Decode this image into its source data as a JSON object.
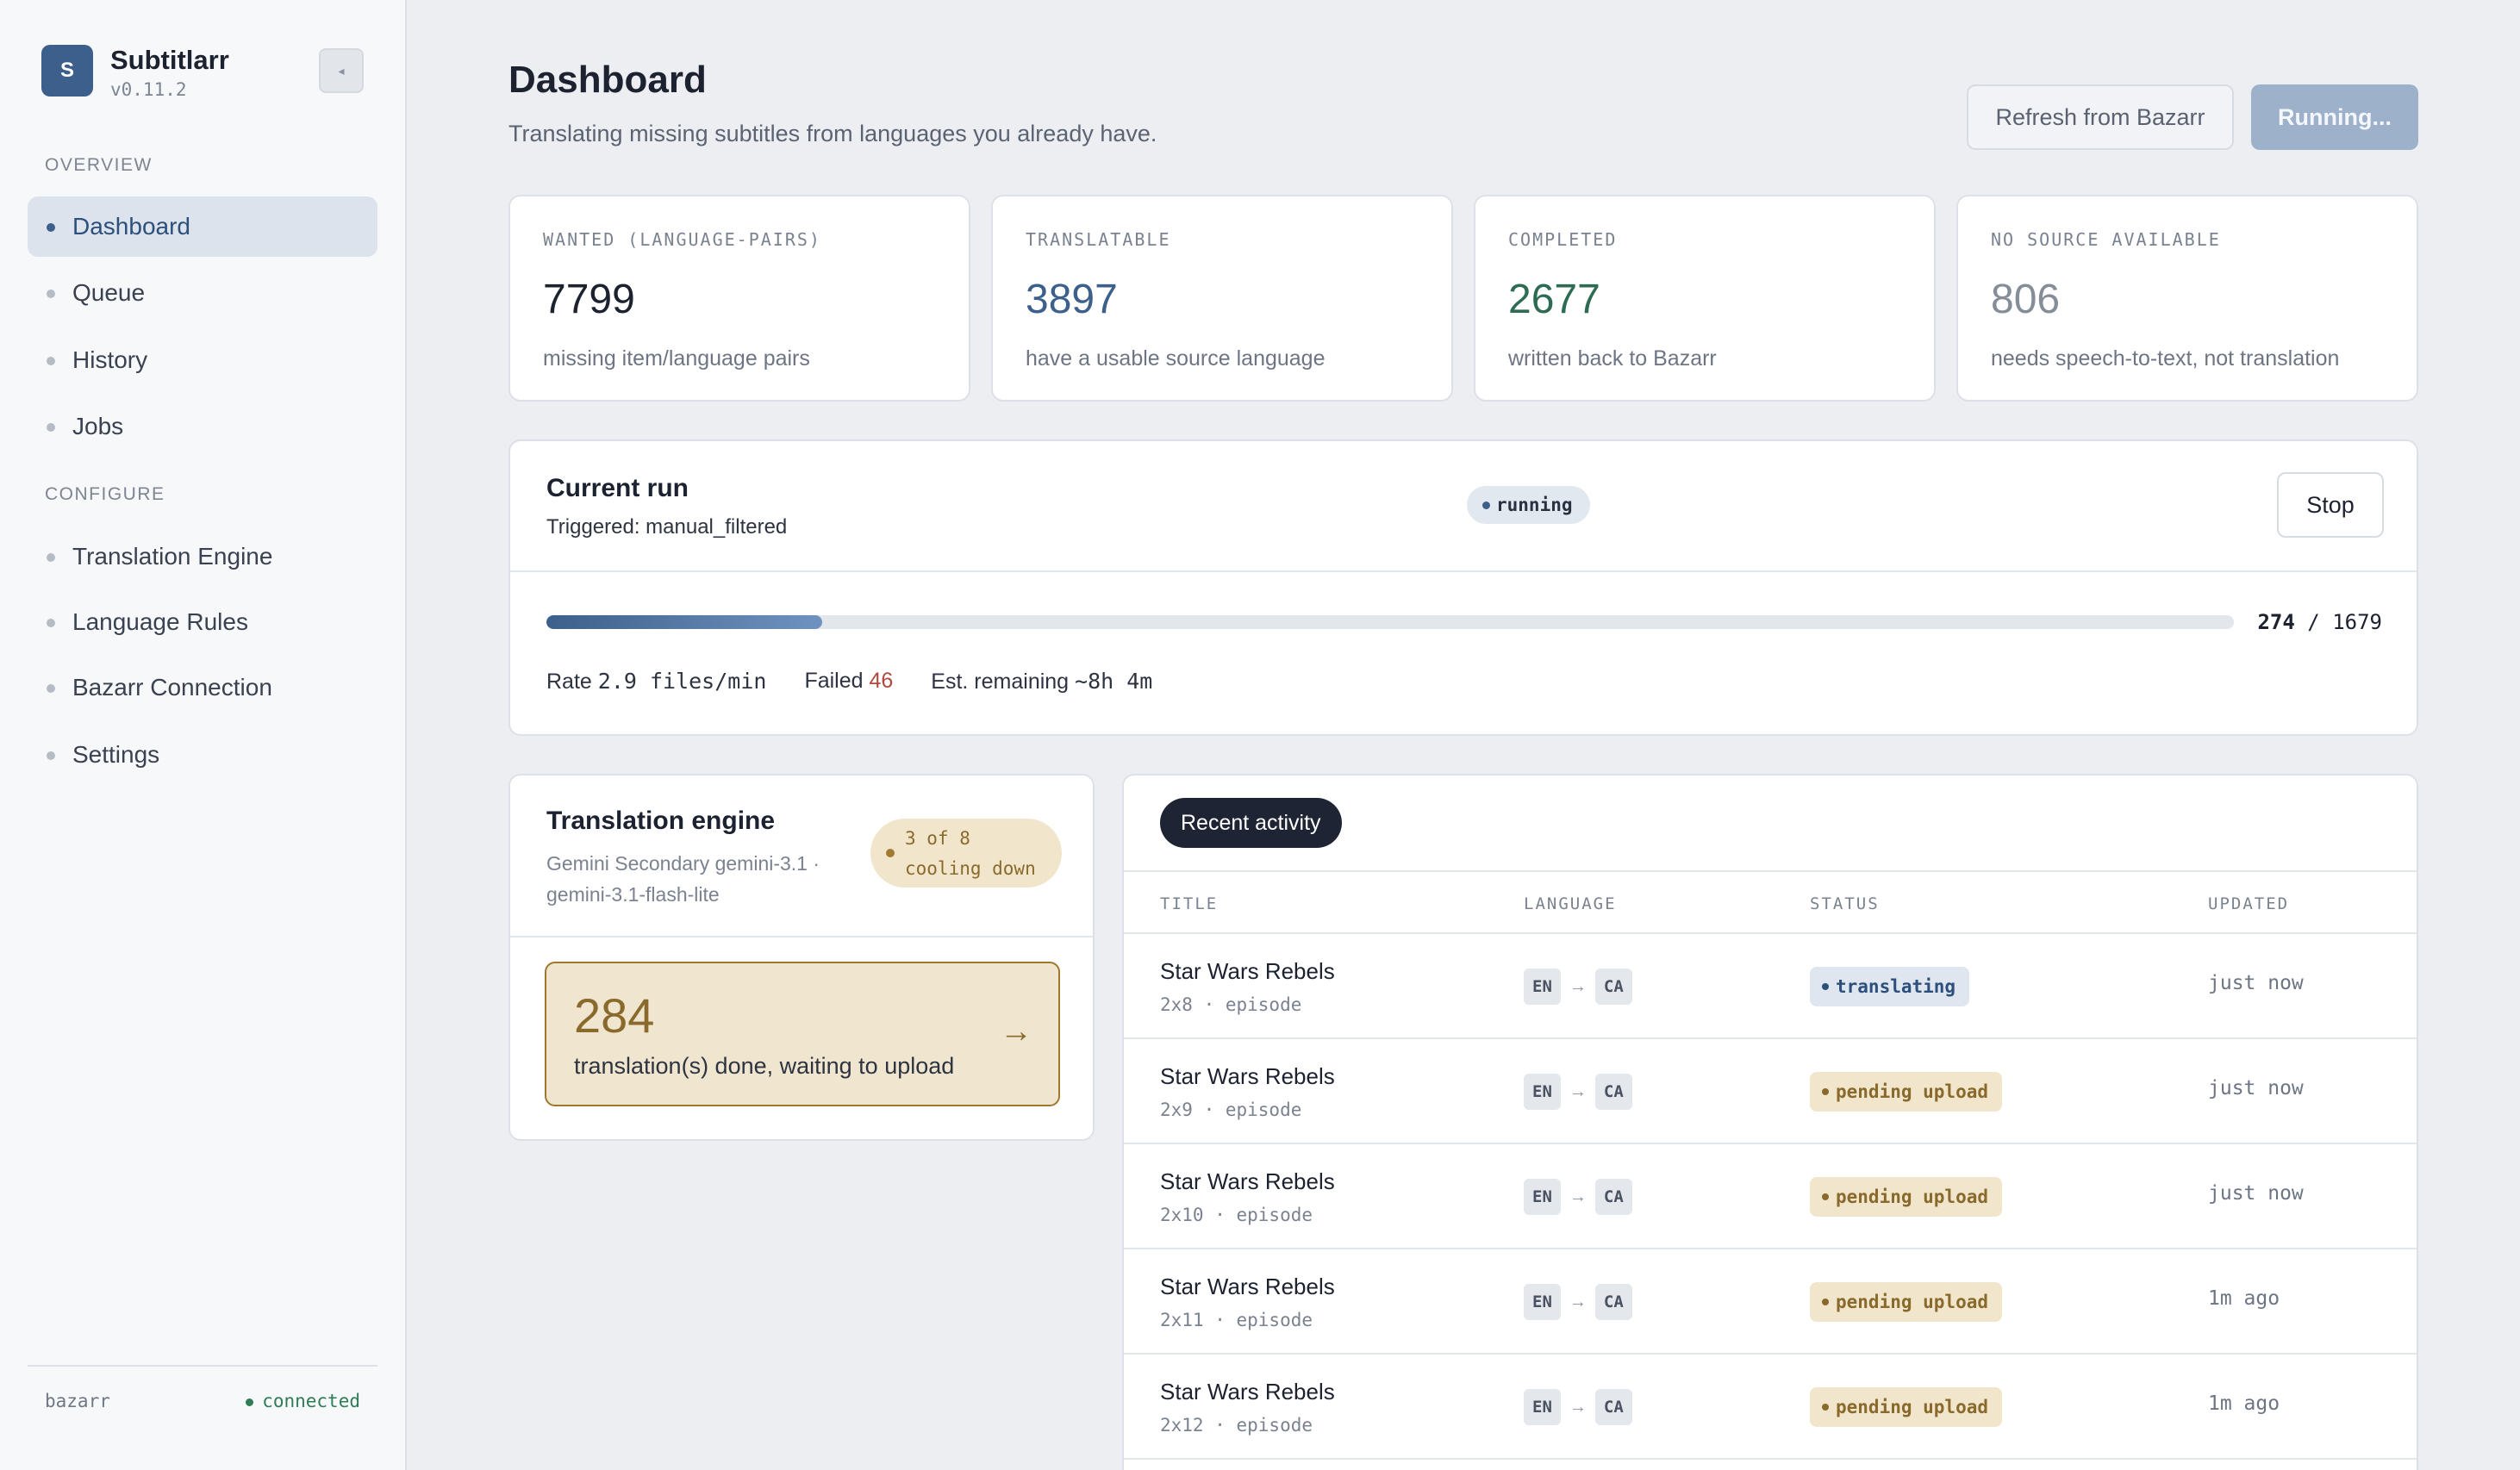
{
  "app": {
    "name": "Subtitlarr",
    "version": "v0.11.2",
    "logo_letter": "S",
    "collapse_icon": "◂"
  },
  "nav": {
    "overview_label": "OVERVIEW",
    "configure_label": "CONFIGURE",
    "overview_items": [
      {
        "label": "Dashboard",
        "active": true
      },
      {
        "label": "Queue"
      },
      {
        "label": "History"
      },
      {
        "label": "Jobs"
      }
    ],
    "configure_items": [
      {
        "label": "Translation Engine"
      },
      {
        "label": "Language Rules"
      },
      {
        "label": "Bazarr Connection"
      },
      {
        "label": "Settings"
      }
    ]
  },
  "footer": {
    "label": "bazarr",
    "status": "connected",
    "status_color": "#2e7d55"
  },
  "header": {
    "title": "Dashboard",
    "subtitle": "Translating missing subtitles from languages you already have.",
    "refresh_label": "Refresh from Bazarr",
    "running_label": "Running..."
  },
  "stats": [
    {
      "label": "WANTED (LANGUAGE-PAIRS)",
      "value": "7799",
      "desc": "missing item/language pairs",
      "color": "#1c2230"
    },
    {
      "label": "TRANSLATABLE",
      "value": "3897",
      "desc": "have a usable source language",
      "color": "#3d5f8c"
    },
    {
      "label": "COMPLETED",
      "value": "2677",
      "desc": "written back to Bazarr",
      "color": "#2e6b53"
    },
    {
      "label": "NO SOURCE AVAILABLE",
      "value": "806",
      "desc": "needs speech-to-text, not translation",
      "color": "#858d99"
    }
  ],
  "run": {
    "title": "Current run",
    "trigger_label": "Triggered:",
    "trigger_value": "manual_filtered",
    "status": "running",
    "stop_label": "Stop",
    "done": "274",
    "separator": "/",
    "total": "1679",
    "progress_fraction": 0.1632,
    "rate_label": "Rate",
    "rate_value": "2.9 files/min",
    "failed_label": "Failed",
    "failed_value": "46",
    "remaining_label": "Est. remaining",
    "remaining_value": "~8h 4m"
  },
  "engine": {
    "title": "Translation engine",
    "subtitle_line1": "Gemini Secondary gemini-3.1 ·",
    "subtitle_line2": "gemini-3.1-flash-lite",
    "cooling_line1": "3 of 8",
    "cooling_line2": "cooling down",
    "upload_count": "284",
    "upload_text": "translation(s) done, waiting to upload",
    "upload_arrow": "→"
  },
  "activity": {
    "tab_label": "Recent activity",
    "columns": {
      "title": "TITLE",
      "language": "LANGUAGE",
      "status": "STATUS",
      "updated": "UPDATED"
    },
    "rows": [
      {
        "title": "Star Wars Rebels",
        "sub": "2x8 · episode",
        "from": "EN",
        "to": "CA",
        "status": "translating",
        "updated": "just now"
      },
      {
        "title": "Star Wars Rebels",
        "sub": "2x9 · episode",
        "from": "EN",
        "to": "CA",
        "status": "pending upload",
        "updated": "just now"
      },
      {
        "title": "Star Wars Rebels",
        "sub": "2x10 · episode",
        "from": "EN",
        "to": "CA",
        "status": "pending upload",
        "updated": "just now"
      },
      {
        "title": "Star Wars Rebels",
        "sub": "2x11 · episode",
        "from": "EN",
        "to": "CA",
        "status": "pending upload",
        "updated": "1m ago"
      },
      {
        "title": "Star Wars Rebels",
        "sub": "2x12 · episode",
        "from": "EN",
        "to": "CA",
        "status": "pending upload",
        "updated": "1m ago"
      }
    ],
    "lang_arrow": "→"
  }
}
